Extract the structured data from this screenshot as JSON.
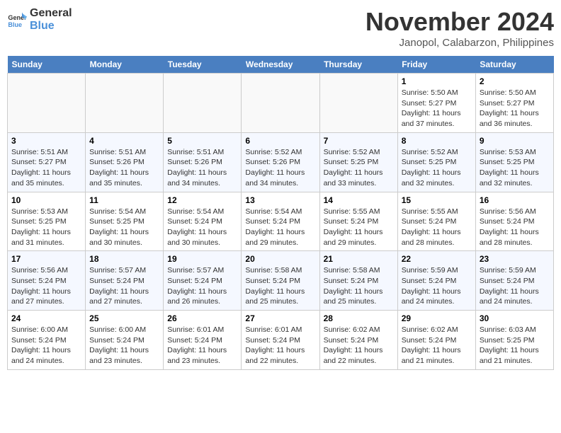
{
  "header": {
    "logo_line1": "General",
    "logo_line2": "Blue",
    "month": "November 2024",
    "location": "Janopol, Calabarzon, Philippines"
  },
  "weekdays": [
    "Sunday",
    "Monday",
    "Tuesday",
    "Wednesday",
    "Thursday",
    "Friday",
    "Saturday"
  ],
  "weeks": [
    [
      {
        "day": "",
        "info": ""
      },
      {
        "day": "",
        "info": ""
      },
      {
        "day": "",
        "info": ""
      },
      {
        "day": "",
        "info": ""
      },
      {
        "day": "",
        "info": ""
      },
      {
        "day": "1",
        "info": "Sunrise: 5:50 AM\nSunset: 5:27 PM\nDaylight: 11 hours and 37 minutes."
      },
      {
        "day": "2",
        "info": "Sunrise: 5:50 AM\nSunset: 5:27 PM\nDaylight: 11 hours and 36 minutes."
      }
    ],
    [
      {
        "day": "3",
        "info": "Sunrise: 5:51 AM\nSunset: 5:27 PM\nDaylight: 11 hours and 35 minutes."
      },
      {
        "day": "4",
        "info": "Sunrise: 5:51 AM\nSunset: 5:26 PM\nDaylight: 11 hours and 35 minutes."
      },
      {
        "day": "5",
        "info": "Sunrise: 5:51 AM\nSunset: 5:26 PM\nDaylight: 11 hours and 34 minutes."
      },
      {
        "day": "6",
        "info": "Sunrise: 5:52 AM\nSunset: 5:26 PM\nDaylight: 11 hours and 34 minutes."
      },
      {
        "day": "7",
        "info": "Sunrise: 5:52 AM\nSunset: 5:25 PM\nDaylight: 11 hours and 33 minutes."
      },
      {
        "day": "8",
        "info": "Sunrise: 5:52 AM\nSunset: 5:25 PM\nDaylight: 11 hours and 32 minutes."
      },
      {
        "day": "9",
        "info": "Sunrise: 5:53 AM\nSunset: 5:25 PM\nDaylight: 11 hours and 32 minutes."
      }
    ],
    [
      {
        "day": "10",
        "info": "Sunrise: 5:53 AM\nSunset: 5:25 PM\nDaylight: 11 hours and 31 minutes."
      },
      {
        "day": "11",
        "info": "Sunrise: 5:54 AM\nSunset: 5:25 PM\nDaylight: 11 hours and 30 minutes."
      },
      {
        "day": "12",
        "info": "Sunrise: 5:54 AM\nSunset: 5:24 PM\nDaylight: 11 hours and 30 minutes."
      },
      {
        "day": "13",
        "info": "Sunrise: 5:54 AM\nSunset: 5:24 PM\nDaylight: 11 hours and 29 minutes."
      },
      {
        "day": "14",
        "info": "Sunrise: 5:55 AM\nSunset: 5:24 PM\nDaylight: 11 hours and 29 minutes."
      },
      {
        "day": "15",
        "info": "Sunrise: 5:55 AM\nSunset: 5:24 PM\nDaylight: 11 hours and 28 minutes."
      },
      {
        "day": "16",
        "info": "Sunrise: 5:56 AM\nSunset: 5:24 PM\nDaylight: 11 hours and 28 minutes."
      }
    ],
    [
      {
        "day": "17",
        "info": "Sunrise: 5:56 AM\nSunset: 5:24 PM\nDaylight: 11 hours and 27 minutes."
      },
      {
        "day": "18",
        "info": "Sunrise: 5:57 AM\nSunset: 5:24 PM\nDaylight: 11 hours and 27 minutes."
      },
      {
        "day": "19",
        "info": "Sunrise: 5:57 AM\nSunset: 5:24 PM\nDaylight: 11 hours and 26 minutes."
      },
      {
        "day": "20",
        "info": "Sunrise: 5:58 AM\nSunset: 5:24 PM\nDaylight: 11 hours and 25 minutes."
      },
      {
        "day": "21",
        "info": "Sunrise: 5:58 AM\nSunset: 5:24 PM\nDaylight: 11 hours and 25 minutes."
      },
      {
        "day": "22",
        "info": "Sunrise: 5:59 AM\nSunset: 5:24 PM\nDaylight: 11 hours and 24 minutes."
      },
      {
        "day": "23",
        "info": "Sunrise: 5:59 AM\nSunset: 5:24 PM\nDaylight: 11 hours and 24 minutes."
      }
    ],
    [
      {
        "day": "24",
        "info": "Sunrise: 6:00 AM\nSunset: 5:24 PM\nDaylight: 11 hours and 24 minutes."
      },
      {
        "day": "25",
        "info": "Sunrise: 6:00 AM\nSunset: 5:24 PM\nDaylight: 11 hours and 23 minutes."
      },
      {
        "day": "26",
        "info": "Sunrise: 6:01 AM\nSunset: 5:24 PM\nDaylight: 11 hours and 23 minutes."
      },
      {
        "day": "27",
        "info": "Sunrise: 6:01 AM\nSunset: 5:24 PM\nDaylight: 11 hours and 22 minutes."
      },
      {
        "day": "28",
        "info": "Sunrise: 6:02 AM\nSunset: 5:24 PM\nDaylight: 11 hours and 22 minutes."
      },
      {
        "day": "29",
        "info": "Sunrise: 6:02 AM\nSunset: 5:24 PM\nDaylight: 11 hours and 21 minutes."
      },
      {
        "day": "30",
        "info": "Sunrise: 6:03 AM\nSunset: 5:25 PM\nDaylight: 11 hours and 21 minutes."
      }
    ]
  ]
}
